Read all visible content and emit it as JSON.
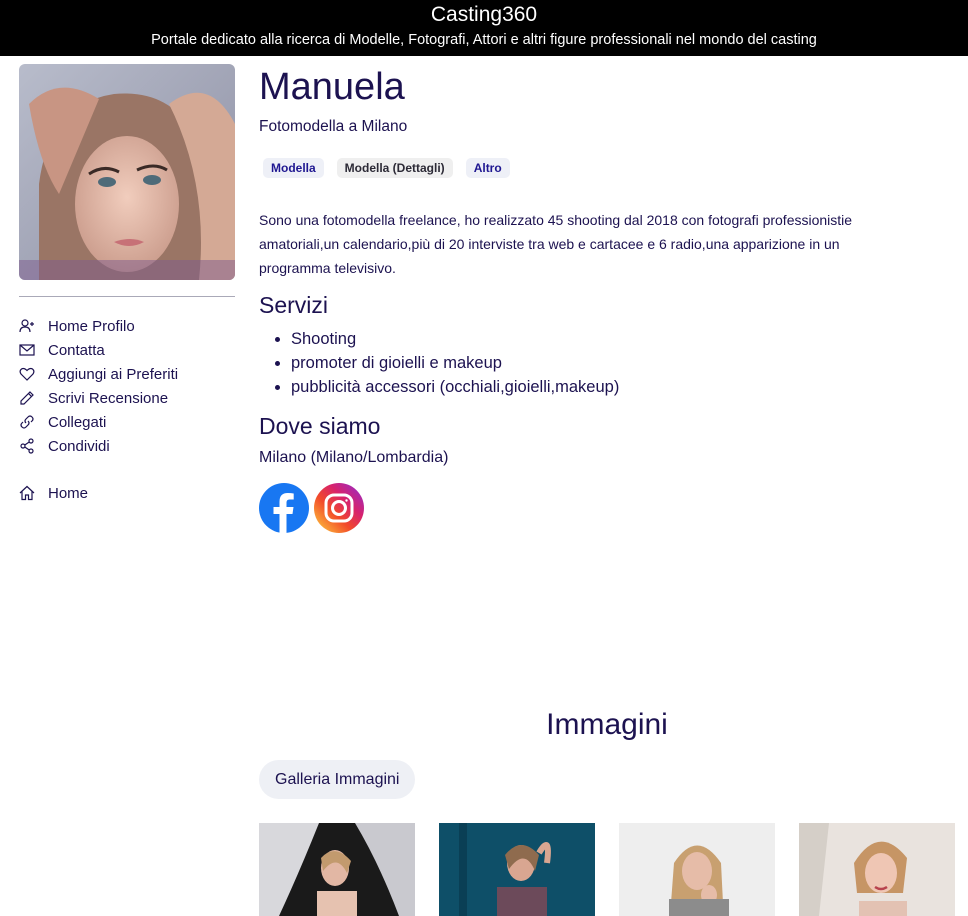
{
  "header": {
    "title": "Casting360",
    "subtitle": "Portale dedicato alla ricerca di Modelle, Fotografi, Attori e altri figure professionali nel mondo del casting"
  },
  "sidebar": {
    "items": [
      {
        "label": "Home Profilo",
        "icon": "add-user-icon"
      },
      {
        "label": "Contatta",
        "icon": "envelope-icon"
      },
      {
        "label": "Aggiungi ai Preferiti",
        "icon": "heart-icon"
      },
      {
        "label": "Scrivi Recensione",
        "icon": "pencil-icon"
      },
      {
        "label": "Collegati",
        "icon": "link-icon"
      },
      {
        "label": "Condividi",
        "icon": "share-icon"
      },
      {
        "label": "Home",
        "icon": "home-icon"
      }
    ]
  },
  "profile": {
    "name": "Manuela",
    "role": "Fotomodella a Milano",
    "tags": [
      "Modella",
      "Modella (Dettagli)",
      "Altro"
    ],
    "bio": "Sono una fotomodella freelance, ho realizzato 45 shooting dal 2018 con fotografi professionistie amatoriali,un calendario,più di 20 interviste tra web e cartacee e 6 radio,una apparizione in un programma televisivo.",
    "services_title": "Servizi",
    "services": [
      "Shooting",
      "promoter di gioielli e makeup",
      "pubblicità accessori (occhiali,gioielli,makeup)"
    ],
    "location_title": "Dove siamo",
    "location": "Milano (Milano/Lombardia)",
    "socials": [
      "facebook-icon",
      "instagram-icon"
    ]
  },
  "images": {
    "title": "Immagini",
    "gallery_button": "Galleria Immagini"
  },
  "colors": {
    "text": "#1c1250",
    "facebook": "#1877f2",
    "tag_text": "#1f1791"
  }
}
